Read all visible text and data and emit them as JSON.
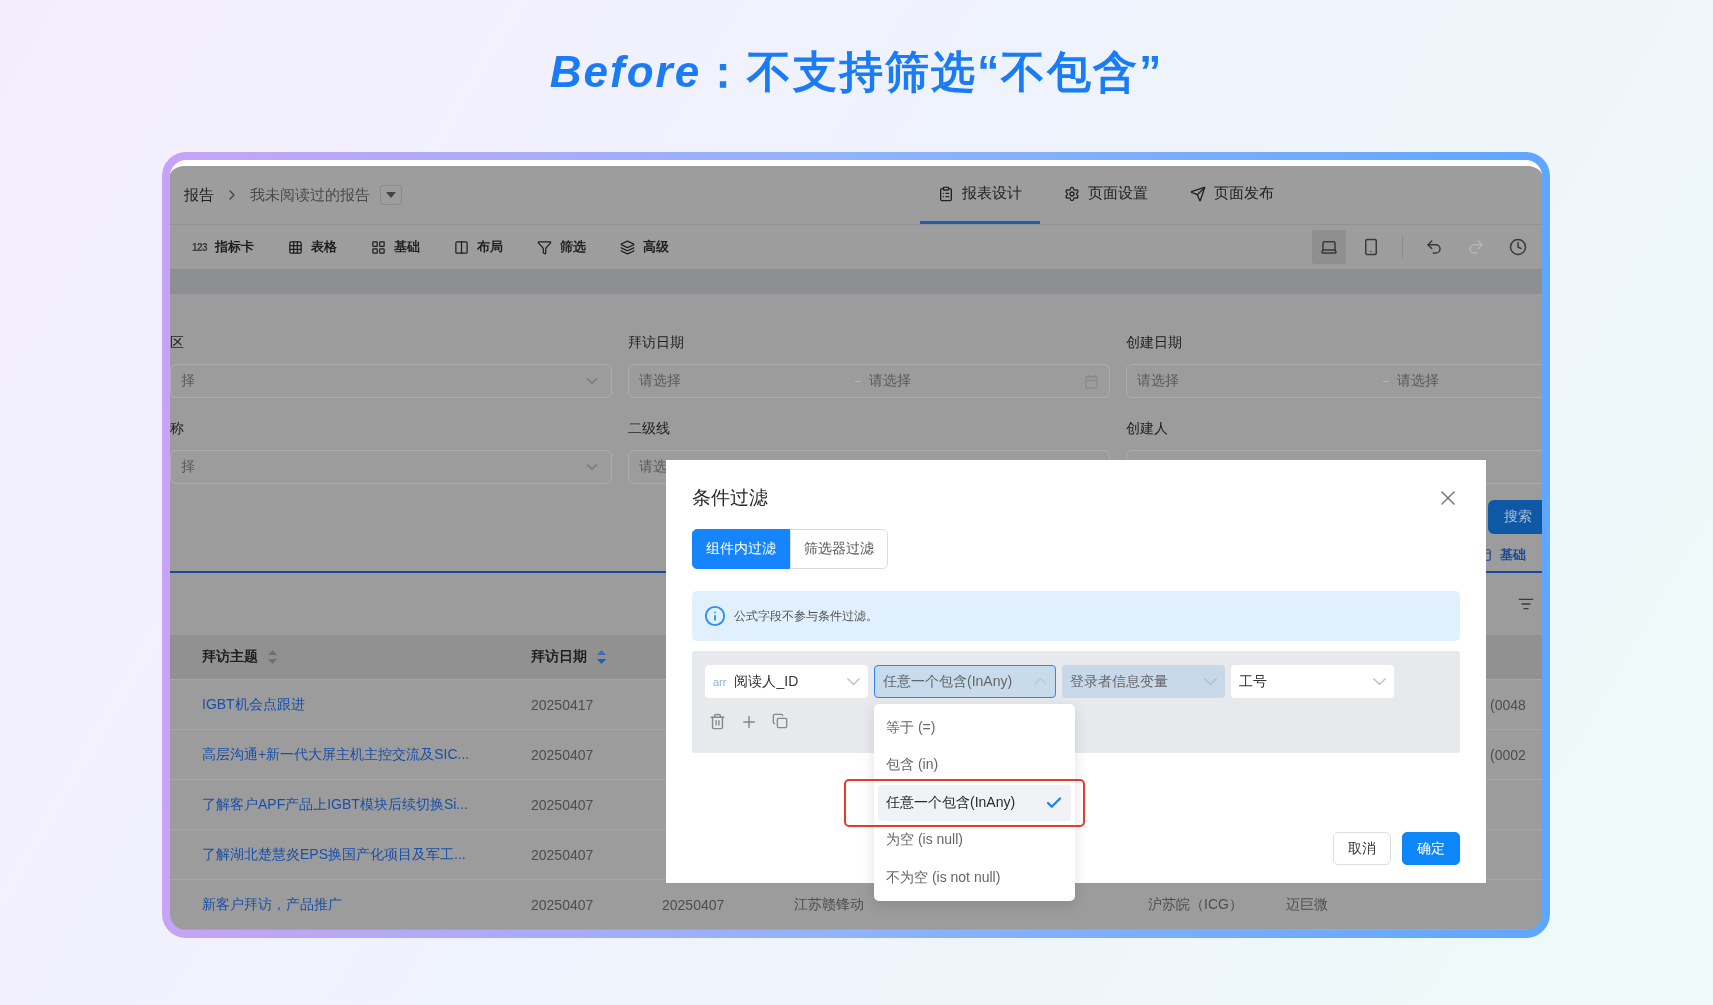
{
  "headline": "*Before*：不支持筛选“不包含”",
  "breadcrumb": {
    "parent": "报告",
    "current": "我未阅读过的报告"
  },
  "nav_tabs": [
    {
      "label": "报表设计",
      "kind": "design",
      "selected": true
    },
    {
      "label": "页面设置",
      "kind": "settings",
      "selected": false
    },
    {
      "label": "页面发布",
      "kind": "publish",
      "selected": false
    }
  ],
  "toolbar": [
    {
      "label": "指标卡",
      "kind": "metric",
      "icon_text": "123"
    },
    {
      "label": "表格",
      "kind": "table"
    },
    {
      "label": "基础",
      "kind": "basic"
    },
    {
      "label": "布局",
      "kind": "layout"
    },
    {
      "label": "筛选",
      "kind": "filter"
    },
    {
      "label": "高级",
      "kind": "advanced"
    }
  ],
  "device_modes": [
    {
      "kind": "desktop",
      "selected": true
    },
    {
      "kind": "mobile",
      "selected": false
    }
  ],
  "history_actions": [
    {
      "kind": "undo",
      "disabled": false
    },
    {
      "kind": "redo",
      "disabled": true
    },
    {
      "kind": "history",
      "disabled": false
    }
  ],
  "filters": [
    {
      "label": "区",
      "kind": "select",
      "placeholder": "择"
    },
    {
      "label": "拜访日期",
      "kind": "date_range",
      "placeholders": [
        "请选择",
        "请选择"
      ]
    },
    {
      "label": "创建日期",
      "kind": "date_range",
      "placeholders": [
        "请选择",
        "请选择"
      ]
    },
    {
      "label": "称",
      "kind": "select",
      "placeholder": "择"
    },
    {
      "label": "二级线",
      "kind": "select",
      "placeholder": "请选"
    },
    {
      "label": "创建人",
      "kind": "select"
    }
  ],
  "search_button": "搜索",
  "view_tab": "基础",
  "table": {
    "columns": [
      {
        "label": "拜访主题",
        "sorted": false
      },
      {
        "label": "拜访日期",
        "sorted": true
      }
    ],
    "rows": [
      {
        "subject": "IGBT机会点跟进",
        "visit_date": "20250417",
        "column_7": "(0048"
      },
      {
        "subject": "高层沟通+新一代大屏主机主控交流及SIC...",
        "visit_date": "20250407",
        "column_7": "(0002"
      },
      {
        "subject": "了解客户APF产品上IGBT模块后续切换Si...",
        "visit_date": "20250407"
      },
      {
        "subject": "了解湖北楚慧炎EPS换国产化项目及军工...",
        "visit_date": "20250407"
      },
      {
        "subject": "新客户拜访，产品推广",
        "visit_date": "20250407",
        "column_3": "20250407",
        "column_4": "江苏赣锋动",
        "column_5": "沪苏皖（ICG）",
        "column_6": "迈巨微"
      }
    ]
  },
  "modal": {
    "title": "条件过滤",
    "tabs": [
      {
        "label": "组件内过滤",
        "selected": true
      },
      {
        "label": "筛选器过滤",
        "selected": false
      }
    ],
    "notice": "公式字段不参与条件过滤。",
    "condition": {
      "field_type": "arr",
      "field": "阅读人_ID",
      "operator": "任意一个包含(InAny)",
      "value_source": "登录者信息变量",
      "value_field": "工号"
    },
    "operator_options": [
      {
        "label": "等于 (=)",
        "selected": false
      },
      {
        "label": "包含 (in)",
        "selected": false
      },
      {
        "label": "任意一个包含(InAny)",
        "selected": true
      },
      {
        "label": "为空 (is null)",
        "selected": false
      },
      {
        "label": "不为空 (is not null)",
        "selected": false
      }
    ],
    "buttons": [
      {
        "label": "取消",
        "kind": "default"
      },
      {
        "label": "确定",
        "kind": "primary"
      }
    ]
  }
}
